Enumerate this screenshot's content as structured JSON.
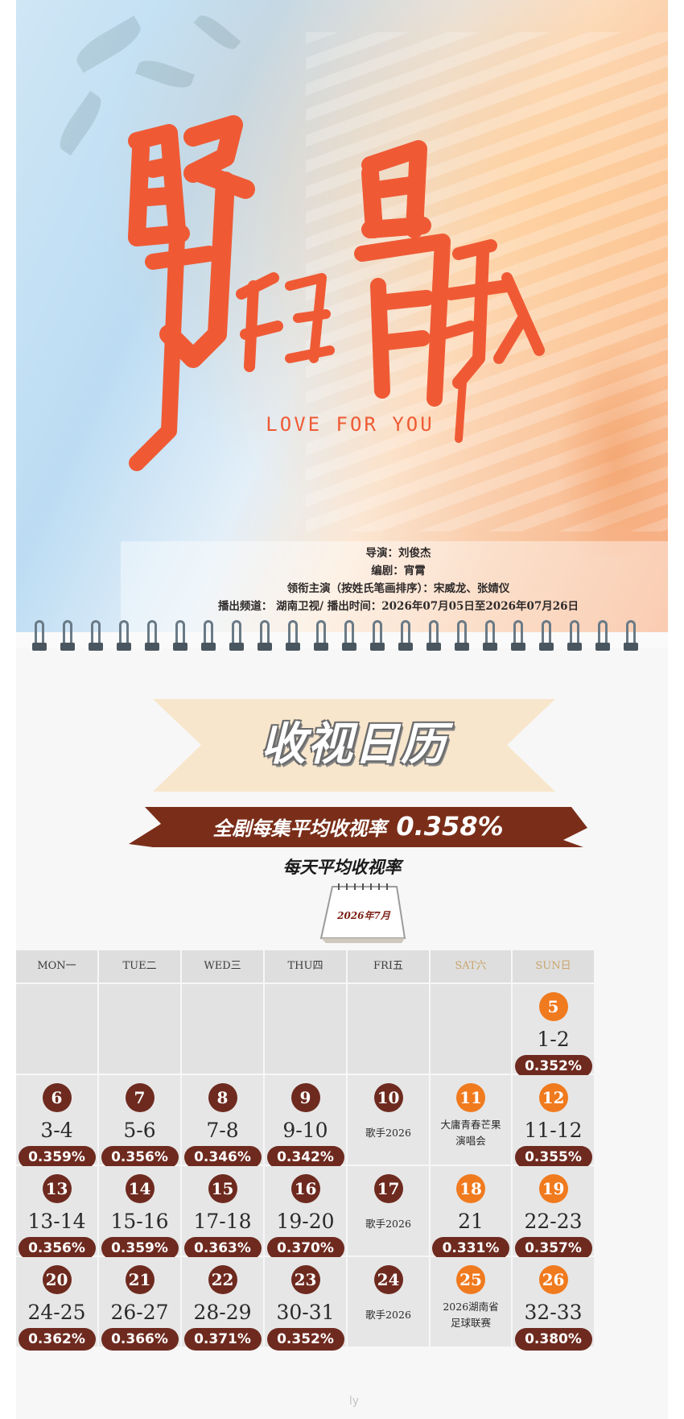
{
  "poster": {
    "subtitle": "LOVE FOR YOU",
    "credits": [
      "导演：刘俊杰",
      "编剧：宵霄",
      "领衔主演（按姓氏笔画排序）：宋威龙、张婧仪",
      "播出频道： 湖南卫视/ 播出时间：2026年07月05日至2026年07月26日"
    ]
  },
  "heading": {
    "title": "收视日历",
    "average_label": "全剧每集平均收视率",
    "average_value": "0.358%",
    "daily_title": "每天平均收视率"
  },
  "month_label": "2026年7月",
  "weekdays": [
    "MON一",
    "TUE二",
    "WED三",
    "THU四",
    "FRI五",
    "SAT六",
    "SUN日"
  ],
  "colors": {
    "brown": "#6e2a1f",
    "orange": "#f07a1e",
    "weekend_header": "#c9a46b",
    "title_red": "#ef5a35"
  },
  "weeks": [
    [
      null,
      null,
      null,
      null,
      null,
      null,
      {
        "day": "5",
        "style": "orange",
        "episodes": "1-2",
        "rating": "0.352%"
      }
    ],
    [
      {
        "day": "6",
        "style": "brown",
        "episodes": "3-4",
        "rating": "0.359%"
      },
      {
        "day": "7",
        "style": "brown",
        "episodes": "5-6",
        "rating": "0.356%"
      },
      {
        "day": "8",
        "style": "brown",
        "episodes": "7-8",
        "rating": "0.346%"
      },
      {
        "day": "9",
        "style": "brown",
        "episodes": "9-10",
        "rating": "0.342%"
      },
      {
        "day": "10",
        "style": "brown",
        "note": "歌手2026"
      },
      {
        "day": "11",
        "style": "orange",
        "note": "大庸青春芒果演唱会"
      },
      {
        "day": "12",
        "style": "orange",
        "episodes": "11-12",
        "rating": "0.355%"
      }
    ],
    [
      {
        "day": "13",
        "style": "brown",
        "episodes": "13-14",
        "rating": "0.356%"
      },
      {
        "day": "14",
        "style": "brown",
        "episodes": "15-16",
        "rating": "0.359%"
      },
      {
        "day": "15",
        "style": "brown",
        "episodes": "17-18",
        "rating": "0.363%"
      },
      {
        "day": "16",
        "style": "brown",
        "episodes": "19-20",
        "rating": "0.370%"
      },
      {
        "day": "17",
        "style": "brown",
        "note": "歌手2026"
      },
      {
        "day": "18",
        "style": "orange",
        "episodes": "21",
        "rating": "0.331%"
      },
      {
        "day": "19",
        "style": "orange",
        "episodes": "22-23",
        "rating": "0.357%"
      }
    ],
    [
      {
        "day": "20",
        "style": "brown",
        "episodes": "24-25",
        "rating": "0.362%"
      },
      {
        "day": "21",
        "style": "brown",
        "episodes": "26-27",
        "rating": "0.366%"
      },
      {
        "day": "22",
        "style": "brown",
        "episodes": "28-29",
        "rating": "0.371%"
      },
      {
        "day": "23",
        "style": "brown",
        "episodes": "30-31",
        "rating": "0.352%"
      },
      {
        "day": "24",
        "style": "brown",
        "note": "歌手2026"
      },
      {
        "day": "25",
        "style": "orange",
        "note": "2026湖南省足球联赛"
      },
      {
        "day": "26",
        "style": "orange",
        "episodes": "32-33",
        "rating": "0.380%"
      }
    ]
  ],
  "watermark": "ly"
}
